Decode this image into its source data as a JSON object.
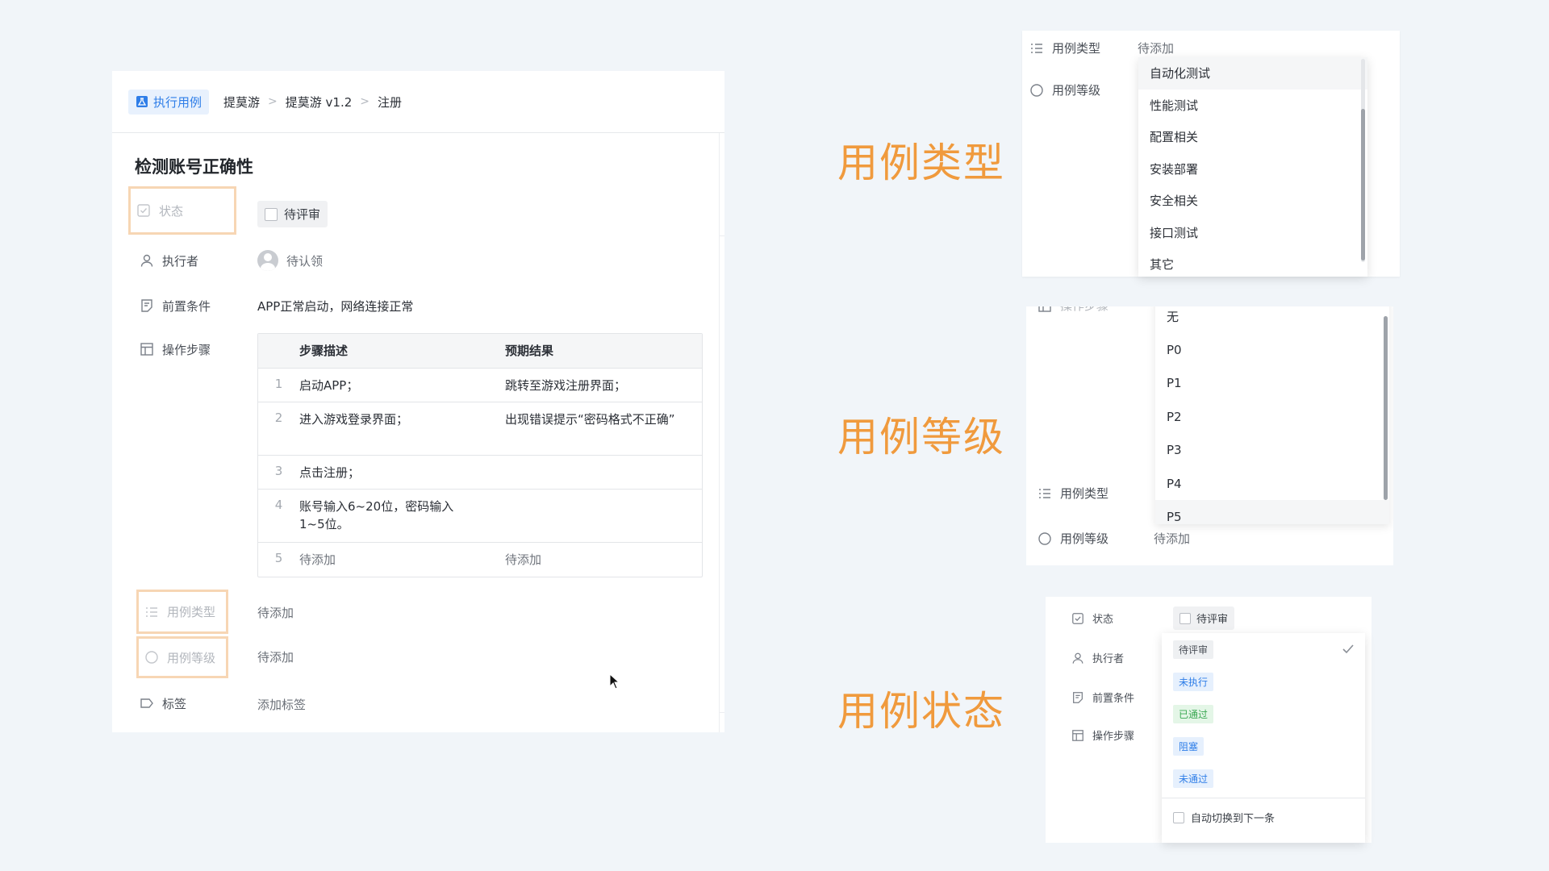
{
  "breadcrumb": {
    "exec_label": "执行用例",
    "items": [
      "提莫游",
      "提莫游 v1.2",
      "注册"
    ],
    "sep": ">"
  },
  "case": {
    "title": "检测账号正确性",
    "fields": {
      "status": {
        "label": "状态",
        "value": "待评审"
      },
      "executor": {
        "label": "执行者",
        "value": "待认领"
      },
      "precondition": {
        "label": "前置条件",
        "value": "APP正常启动，网络连接正常"
      },
      "steps": {
        "label": "操作步骤"
      },
      "type": {
        "label": "用例类型",
        "value": "待添加"
      },
      "level": {
        "label": "用例等级",
        "value": "待添加"
      },
      "tags": {
        "label": "标签",
        "value": "添加标签"
      }
    },
    "steps_table": {
      "headers": [
        "步骤描述",
        "预期结果"
      ],
      "rows": [
        {
          "num": "1",
          "desc": "启动APP；",
          "expected": "跳转至游戏注册界面；"
        },
        {
          "num": "2",
          "desc": "进入游戏登录界面；",
          "expected": "出现错误提示“密码格式不正确”"
        },
        {
          "num": "3",
          "desc": "点击注册；",
          "expected": ""
        },
        {
          "num": "4",
          "desc": "账号输入6~20位，密码输入1~5位。",
          "expected": ""
        },
        {
          "num": "5",
          "desc": "待添加",
          "expected": "待添加"
        }
      ]
    }
  },
  "big_titles": {
    "type": "用例类型",
    "level": "用例等级",
    "status": "用例状态"
  },
  "type_panel": {
    "type_label": "用例类型",
    "type_value": "待添加",
    "level_label": "用例等级",
    "options": [
      "自动化测试",
      "性能测试",
      "配置相关",
      "安装部署",
      "安全相关",
      "接口测试",
      "其它"
    ]
  },
  "level_panel": {
    "clipped_label": "操作步骤",
    "options": [
      "无",
      "P0",
      "P1",
      "P2",
      "P3",
      "P4",
      "P5"
    ],
    "type_label": "用例类型",
    "level_label": "用例等级",
    "level_value": "待添加"
  },
  "status_panel": {
    "status_label": "状态",
    "status_value": "待评审",
    "executor_label": "执行者",
    "precondition_label": "前置条件",
    "steps_label": "操作步骤",
    "options": [
      {
        "label": "待评审",
        "color": "gray",
        "selected": true
      },
      {
        "label": "未执行",
        "color": "blue"
      },
      {
        "label": "已通过",
        "color": "green"
      },
      {
        "label": "阻塞",
        "color": "blue"
      },
      {
        "label": "未通过",
        "color": "blue"
      }
    ],
    "auto_next": "自动切换到下一条"
  },
  "colors": {
    "accent_blue": "#2f7ee8",
    "orange_title": "#f09a3d",
    "highlight_box": "#f7d6b4",
    "background": "#f1f5f9"
  }
}
